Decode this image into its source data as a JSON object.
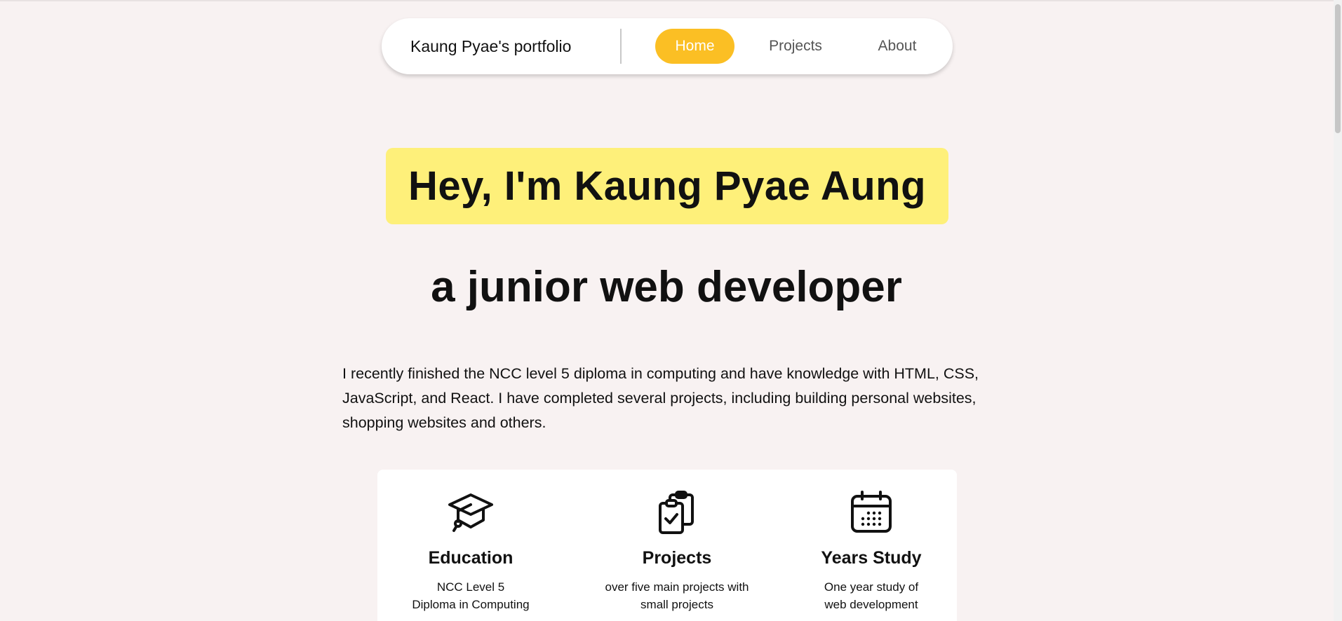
{
  "nav": {
    "brand": "Kaung Pyae's portfolio",
    "items": [
      {
        "label": "Home",
        "active": true
      },
      {
        "label": "Projects",
        "active": false
      },
      {
        "label": "About",
        "active": false
      }
    ],
    "accent": "#fbbf24"
  },
  "hero": {
    "title": "Hey, I'm Kaung Pyae Aung",
    "highlight_color": "#fef07a",
    "subtitle": "a junior web developer",
    "intro": "I recently finished the NCC level 5 diploma in computing and have knowledge with HTML, CSS, JavaScript, and React. I have completed several projects, including building personal websites, shopping websites and others."
  },
  "cards": [
    {
      "icon": "graduation-cap-icon",
      "title": "Education",
      "line1": "NCC Level 5",
      "line2": "Diploma in Computing"
    },
    {
      "icon": "clipboard-check-icon",
      "title": "Projects",
      "line1": "over five main projects with",
      "line2": "small projects"
    },
    {
      "icon": "calendar-icon",
      "title": "Years Study",
      "line1": "One year study of",
      "line2": "web development"
    }
  ]
}
